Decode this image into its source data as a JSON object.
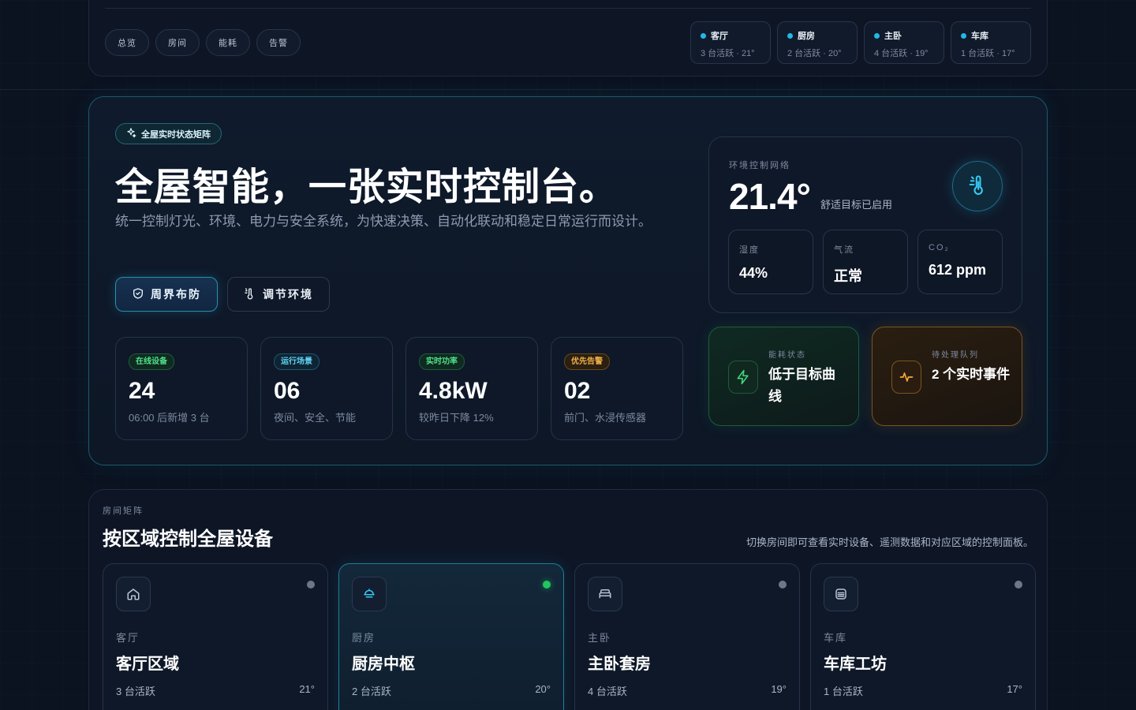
{
  "nav": {
    "tabs": [
      {
        "label": "总览"
      },
      {
        "label": "房间"
      },
      {
        "label": "能耗"
      },
      {
        "label": "告警"
      }
    ],
    "room_chips": [
      {
        "name": "客厅",
        "status": "3 台活跃 · 21°"
      },
      {
        "name": "厨房",
        "status": "2 台活跃 · 20°"
      },
      {
        "name": "主卧",
        "status": "4 台活跃 · 19°"
      },
      {
        "name": "车库",
        "status": "1 台活跃 · 17°"
      }
    ]
  },
  "hero": {
    "badge": "全屋实时状态矩阵",
    "title": "全屋智能，一张实时控制台。",
    "description": "统一控制灯光、环境、电力与安全系统，为快速决策、自动化联动和稳定日常运行而设计。",
    "primary_button": "周界布防",
    "secondary_button": "调节环境",
    "stats": [
      {
        "tag": "在线设备",
        "value": "24",
        "sub": "06:00 后新增 3 台"
      },
      {
        "tag": "运行场景",
        "value": "06",
        "sub": "夜间、安全、节能"
      },
      {
        "tag": "实时功率",
        "value": "4.8kW",
        "sub": "较昨日下降 12%"
      },
      {
        "tag": "优先告警",
        "value": "02",
        "sub": "前门、水浸传感器"
      }
    ]
  },
  "environment": {
    "label": "环境控制网络",
    "temperature": "21.4°",
    "note": "舒适目标已启用",
    "metrics": [
      {
        "label": "湿度",
        "value": "44%"
      },
      {
        "label": "气流",
        "value": "正常"
      },
      {
        "label": "CO₂",
        "value": "612 ppm"
      }
    ]
  },
  "energy_status": {
    "label": "能耗状态",
    "text": "低于目标曲线"
  },
  "queue_status": {
    "label": "待处理队列",
    "text": "2 个实时事件"
  },
  "rooms": {
    "label": "房间矩阵",
    "title": "按区域控制全屋设备",
    "description": "切换房间即可查看实时设备、遥测数据和对应区域的控制面板。",
    "cards": [
      {
        "tag": "客厅",
        "name": "客厅区域",
        "active": "3 台活跃",
        "temp": "21°"
      },
      {
        "tag": "厨房",
        "name": "厨房中枢",
        "active": "2 台活跃",
        "temp": "20°"
      },
      {
        "tag": "主卧",
        "name": "主卧套房",
        "active": "4 台活跃",
        "temp": "19°"
      },
      {
        "tag": "车库",
        "name": "车库工坊",
        "active": "1 台活跃",
        "temp": "17°"
      }
    ]
  },
  "colors": {
    "accent": "#22b8e6",
    "success": "#22c55e",
    "warning": "#f2b14a",
    "background": "#0b1220"
  }
}
